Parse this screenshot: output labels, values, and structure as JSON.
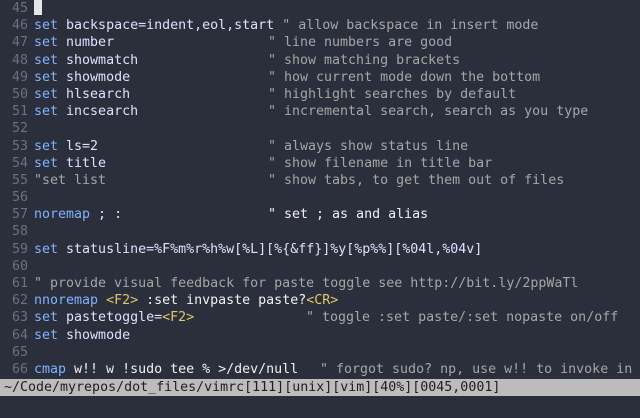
{
  "editor": {
    "lines": [
      {
        "n": "45",
        "parts": []
      },
      {
        "n": "46",
        "parts": [
          {
            "t": "set",
            "c": "kw"
          },
          {
            "t": " backspace=indent,eol,start",
            "c": "opt"
          },
          {
            "t": " \" allow backspace in insert mode",
            "c": "cm"
          }
        ]
      },
      {
        "n": "47",
        "parts": [
          {
            "t": "set",
            "c": "kw"
          },
          {
            "t": " number",
            "c": "opt"
          },
          {
            "t": "\" line numbers are good",
            "c": "cm"
          }
        ]
      },
      {
        "n": "48",
        "parts": [
          {
            "t": "set",
            "c": "kw"
          },
          {
            "t": " showmatch",
            "c": "opt"
          },
          {
            "t": "\" show matching brackets",
            "c": "cm"
          }
        ]
      },
      {
        "n": "49",
        "parts": [
          {
            "t": "set",
            "c": "kw"
          },
          {
            "t": " showmode",
            "c": "opt"
          },
          {
            "t": "\" how current mode down the bottom",
            "c": "cm"
          }
        ]
      },
      {
        "n": "50",
        "parts": [
          {
            "t": "set",
            "c": "kw"
          },
          {
            "t": " hlsearch",
            "c": "opt"
          },
          {
            "t": "\" highlight searches by default",
            "c": "cm"
          }
        ]
      },
      {
        "n": "51",
        "parts": [
          {
            "t": "set",
            "c": "kw"
          },
          {
            "t": " incsearch",
            "c": "opt"
          },
          {
            "t": "\" incremental search, search as you type",
            "c": "cm"
          }
        ]
      },
      {
        "n": "52",
        "parts": []
      },
      {
        "n": "53",
        "parts": [
          {
            "t": "set",
            "c": "kw"
          },
          {
            "t": " ls=2",
            "c": "opt"
          },
          {
            "t": "\" always show status line",
            "c": "cm"
          }
        ]
      },
      {
        "n": "54",
        "parts": [
          {
            "t": "set",
            "c": "kw"
          },
          {
            "t": " title",
            "c": "opt"
          },
          {
            "t": "\" show filename in title bar",
            "c": "cm"
          }
        ]
      },
      {
        "n": "55",
        "parts": [
          {
            "t": "\"set list",
            "c": "cm"
          },
          {
            "t": "\" show tabs, to get them out of files",
            "c": "cm"
          }
        ]
      },
      {
        "n": "56",
        "parts": []
      },
      {
        "n": "57",
        "parts": [
          {
            "t": "noremap",
            "c": "kw"
          },
          {
            "t": " ; :",
            "c": "opt"
          },
          {
            "t": "\" set ; as and alias",
            "c": "val"
          }
        ]
      },
      {
        "n": "58",
        "parts": []
      },
      {
        "n": "59",
        "parts": [
          {
            "t": "set",
            "c": "kw"
          },
          {
            "t": " statusline=%F%m%r%h%w[%L][%{&ff}]%y[%p%%][%04l,%04v]",
            "c": "opt"
          }
        ]
      },
      {
        "n": "60",
        "parts": []
      },
      {
        "n": "61",
        "parts": [
          {
            "t": "\" provide visual feedback for paste toggle see http://bit.ly/2ppWaTl",
            "c": "cm"
          }
        ]
      },
      {
        "n": "62",
        "parts": [
          {
            "t": "nnoremap",
            "c": "kw"
          },
          {
            "t": " ",
            "c": "opt"
          },
          {
            "t": "<F2>",
            "c": "key"
          },
          {
            "t": " :set invpaste paste?",
            "c": "val"
          },
          {
            "t": "<CR>",
            "c": "key"
          }
        ]
      },
      {
        "n": "63",
        "parts": [
          {
            "t": "set",
            "c": "kw"
          },
          {
            "t": " pastetoggle=",
            "c": "opt"
          },
          {
            "t": "<F2>",
            "c": "key"
          },
          {
            "t": "\" toggle :set paste/:set nopaste on/off",
            "c": "cm"
          }
        ]
      },
      {
        "n": "64",
        "parts": [
          {
            "t": "set",
            "c": "kw"
          },
          {
            "t": " showmode",
            "c": "opt"
          }
        ]
      },
      {
        "n": "65",
        "parts": []
      },
      {
        "n": "66",
        "parts": [
          {
            "t": "cmap",
            "c": "kw"
          },
          {
            "t": " w!! w !sudo tee % >/dev/null",
            "c": "val"
          },
          {
            "t": "\" forgot sudo? np, use w!! to invoke in file",
            "c": "cm"
          }
        ]
      }
    ]
  },
  "statusbar": {
    "text": "~/Code/myrepos/dot_files/vimrc[111][unix][vim][40%][0045,0001]"
  }
}
